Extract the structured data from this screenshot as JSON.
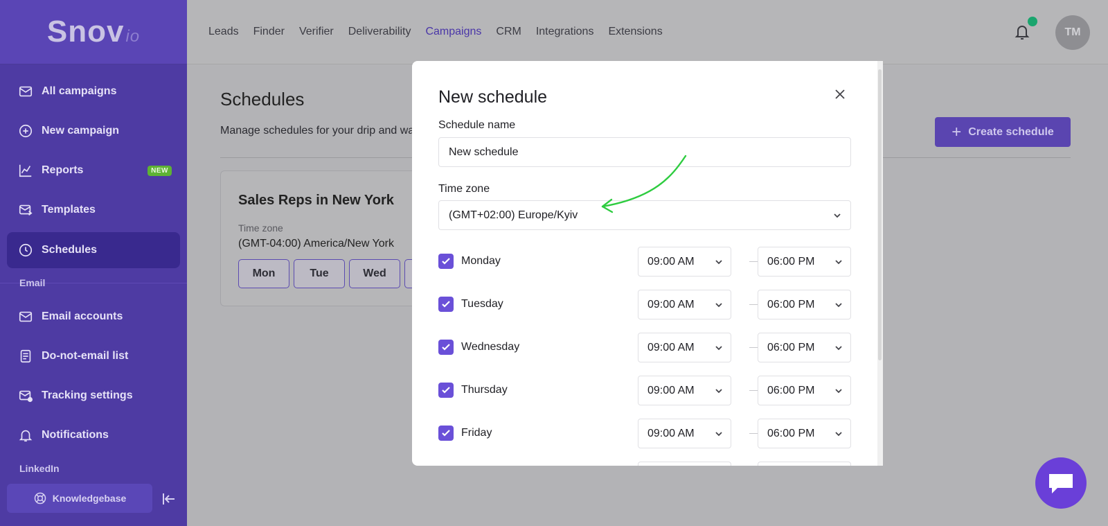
{
  "brand": {
    "logo_main": "Snov",
    "logo_suffix": "io"
  },
  "sidebar": {
    "items": [
      {
        "label": "All campaigns",
        "icon": "mail-icon"
      },
      {
        "label": "New campaign",
        "icon": "plus-circle-icon"
      },
      {
        "label": "Reports",
        "icon": "chart-icon",
        "badge": "NEW"
      },
      {
        "label": "Templates",
        "icon": "mail-template-icon"
      },
      {
        "label": "Schedules",
        "icon": "clock-icon",
        "active": true
      }
    ],
    "section_email": "Email",
    "email_items": [
      {
        "label": "Email accounts",
        "icon": "mail-icon"
      },
      {
        "label": "Do-not-email list",
        "icon": "document-icon"
      },
      {
        "label": "Tracking settings",
        "icon": "mail-settings-icon"
      },
      {
        "label": "Notifications",
        "icon": "bell-icon"
      }
    ],
    "section_linkedin": "LinkedIn",
    "knowledgebase": "Knowledgebase"
  },
  "topnav": {
    "links": [
      "Leads",
      "Finder",
      "Verifier",
      "Deliverability",
      "Campaigns",
      "CRM",
      "Integrations",
      "Extensions"
    ],
    "active": "Campaigns",
    "avatar_initials": "TM"
  },
  "main": {
    "title": "Schedules",
    "subtitle": "Manage schedules for your drip and warm-up campaigns",
    "create_button": "Create schedule",
    "card": {
      "title": "Sales Reps in New York",
      "tz_label": "Time zone",
      "tz_value": "(GMT-04:00) America/New York",
      "days": [
        "Mon",
        "Tue",
        "Wed"
      ]
    }
  },
  "modal": {
    "title": "New schedule",
    "name_label": "Schedule name",
    "name_value": "New schedule",
    "tz_label": "Time zone",
    "tz_value": "(GMT+02:00) Europe/Kyiv",
    "days": [
      {
        "day": "Monday",
        "checked": true,
        "from": "09:00 AM",
        "to": "06:00 PM"
      },
      {
        "day": "Tuesday",
        "checked": true,
        "from": "09:00 AM",
        "to": "06:00 PM"
      },
      {
        "day": "Wednesday",
        "checked": true,
        "from": "09:00 AM",
        "to": "06:00 PM"
      },
      {
        "day": "Thursday",
        "checked": true,
        "from": "09:00 AM",
        "to": "06:00 PM"
      },
      {
        "day": "Friday",
        "checked": true,
        "from": "09:00 AM",
        "to": "06:00 PM"
      }
    ]
  },
  "colors": {
    "sidebar": "#4e3ba3",
    "accent": "#6a50d8",
    "arrow": "#2ecc40",
    "chat": "#6a3fd8"
  }
}
